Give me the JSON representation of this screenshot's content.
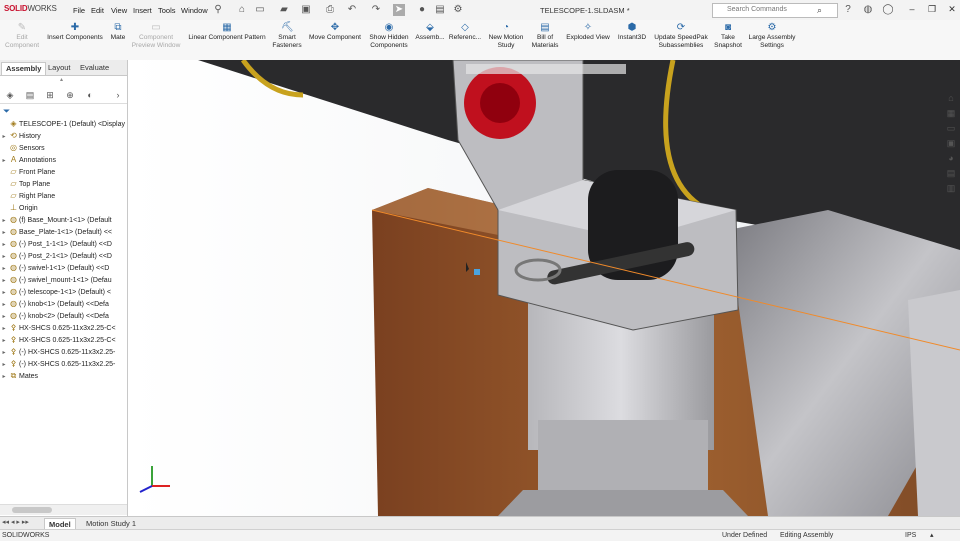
{
  "app": {
    "brand_bold": "SOLID",
    "brand_rest": "WORKS"
  },
  "menu": [
    "File",
    "Edit",
    "View",
    "Insert",
    "Tools",
    "Window"
  ],
  "document_title": "TELESCOPE-1.SLDASM *",
  "search": {
    "placeholder": "Search Commands"
  },
  "commands": [
    {
      "label": "Edit Component",
      "icon": "edit-component-icon",
      "enabled": false
    },
    {
      "label": "Insert Components",
      "icon": "insert-components-icon",
      "enabled": true
    },
    {
      "label": "Mate",
      "icon": "mate-icon",
      "enabled": true
    },
    {
      "label": "Component Preview Window",
      "icon": "preview-window-icon",
      "enabled": false
    },
    {
      "label": "Linear Component Pattern",
      "icon": "linear-pattern-icon",
      "enabled": true
    },
    {
      "label": "Smart Fasteners",
      "icon": "smart-fasteners-icon",
      "enabled": true
    },
    {
      "label": "Move Component",
      "icon": "move-component-icon",
      "enabled": true
    },
    {
      "label": "Show Hidden Components",
      "icon": "show-hidden-icon",
      "enabled": true
    },
    {
      "label": "Assemb...",
      "icon": "assembly-features-icon",
      "enabled": true
    },
    {
      "label": "Referenc...",
      "icon": "reference-geometry-icon",
      "enabled": true
    },
    {
      "label": "New Motion Study",
      "icon": "motion-study-icon",
      "enabled": true
    },
    {
      "label": "Bill of Materials",
      "icon": "bom-icon",
      "enabled": true
    },
    {
      "label": "Exploded View",
      "icon": "exploded-view-icon",
      "enabled": true
    },
    {
      "label": "Instant3D",
      "icon": "instant3d-icon",
      "enabled": true
    },
    {
      "label": "Update SpeedPak Subassemblies",
      "icon": "speedpak-icon",
      "enabled": true
    },
    {
      "label": "Take Snapshot",
      "icon": "snapshot-icon",
      "enabled": true
    },
    {
      "label": "Large Assembly Settings",
      "icon": "large-assembly-icon",
      "enabled": true
    }
  ],
  "panel_tabs": [
    "Assembly",
    "Layout",
    "Evaluate"
  ],
  "tree": [
    {
      "label": "TELESCOPE-1 (Default) <Display S",
      "icon": "assembly-icon",
      "exp": ""
    },
    {
      "label": "History",
      "icon": "history-icon",
      "exp": "▸"
    },
    {
      "label": "Sensors",
      "icon": "sensors-icon",
      "exp": ""
    },
    {
      "label": "Annotations",
      "icon": "annotations-icon",
      "exp": "▸"
    },
    {
      "label": "Front Plane",
      "icon": "plane-icon",
      "exp": ""
    },
    {
      "label": "Top Plane",
      "icon": "plane-icon",
      "exp": ""
    },
    {
      "label": "Right Plane",
      "icon": "plane-icon",
      "exp": ""
    },
    {
      "label": "Origin",
      "icon": "origin-icon",
      "exp": ""
    },
    {
      "label": "(f) Base_Mount-1<1> (Default",
      "icon": "part-icon",
      "exp": "▸"
    },
    {
      "label": "Base_Plate-1<1> (Default) <<",
      "icon": "part-icon",
      "exp": "▸"
    },
    {
      "label": "(-) Post_1-1<1> (Default) <<D",
      "icon": "part-icon",
      "exp": "▸"
    },
    {
      "label": "(-) Post_2-1<1> (Default) <<D",
      "icon": "part-icon",
      "exp": "▸"
    },
    {
      "label": "(-) swivel-1<1> (Default) <<D",
      "icon": "part-icon",
      "exp": "▸"
    },
    {
      "label": "(-) swivel_mount-1<1> (Defau",
      "icon": "part-icon",
      "exp": "▸"
    },
    {
      "label": "(-) telescope-1<1> (Default) <",
      "icon": "part-icon",
      "exp": "▸"
    },
    {
      "label": "(-) knob<1> (Default) <<Defa",
      "icon": "part-icon",
      "exp": "▸"
    },
    {
      "label": "(-) knob<2> (Default) <<Defa",
      "icon": "part-icon",
      "exp": "▸"
    },
    {
      "label": "HX-SHCS 0.625-11x3x2.25-C<",
      "icon": "fastener-icon",
      "exp": "▸"
    },
    {
      "label": "HX-SHCS 0.625-11x3x2.25-C<",
      "icon": "fastener-icon",
      "exp": "▸"
    },
    {
      "label": "(-) HX-SHCS 0.625-11x3x2.25-",
      "icon": "fastener-icon",
      "exp": "▸"
    },
    {
      "label": "(-) HX-SHCS 0.625-11x3x2.25-",
      "icon": "fastener-icon",
      "exp": "▸"
    },
    {
      "label": "Mates",
      "icon": "mates-icon",
      "exp": "▸"
    }
  ],
  "bottom_tabs": [
    "Model",
    "Motion Study 1"
  ],
  "status": {
    "app": "SOLIDWORKS",
    "state": "Under Defined",
    "mode": "Editing Assembly",
    "units": "IPS"
  },
  "colors": {
    "accent": "#2b6aa8",
    "knob": "#c0101e",
    "wood": "#8a4e28",
    "metal": "#a6a6aa"
  }
}
